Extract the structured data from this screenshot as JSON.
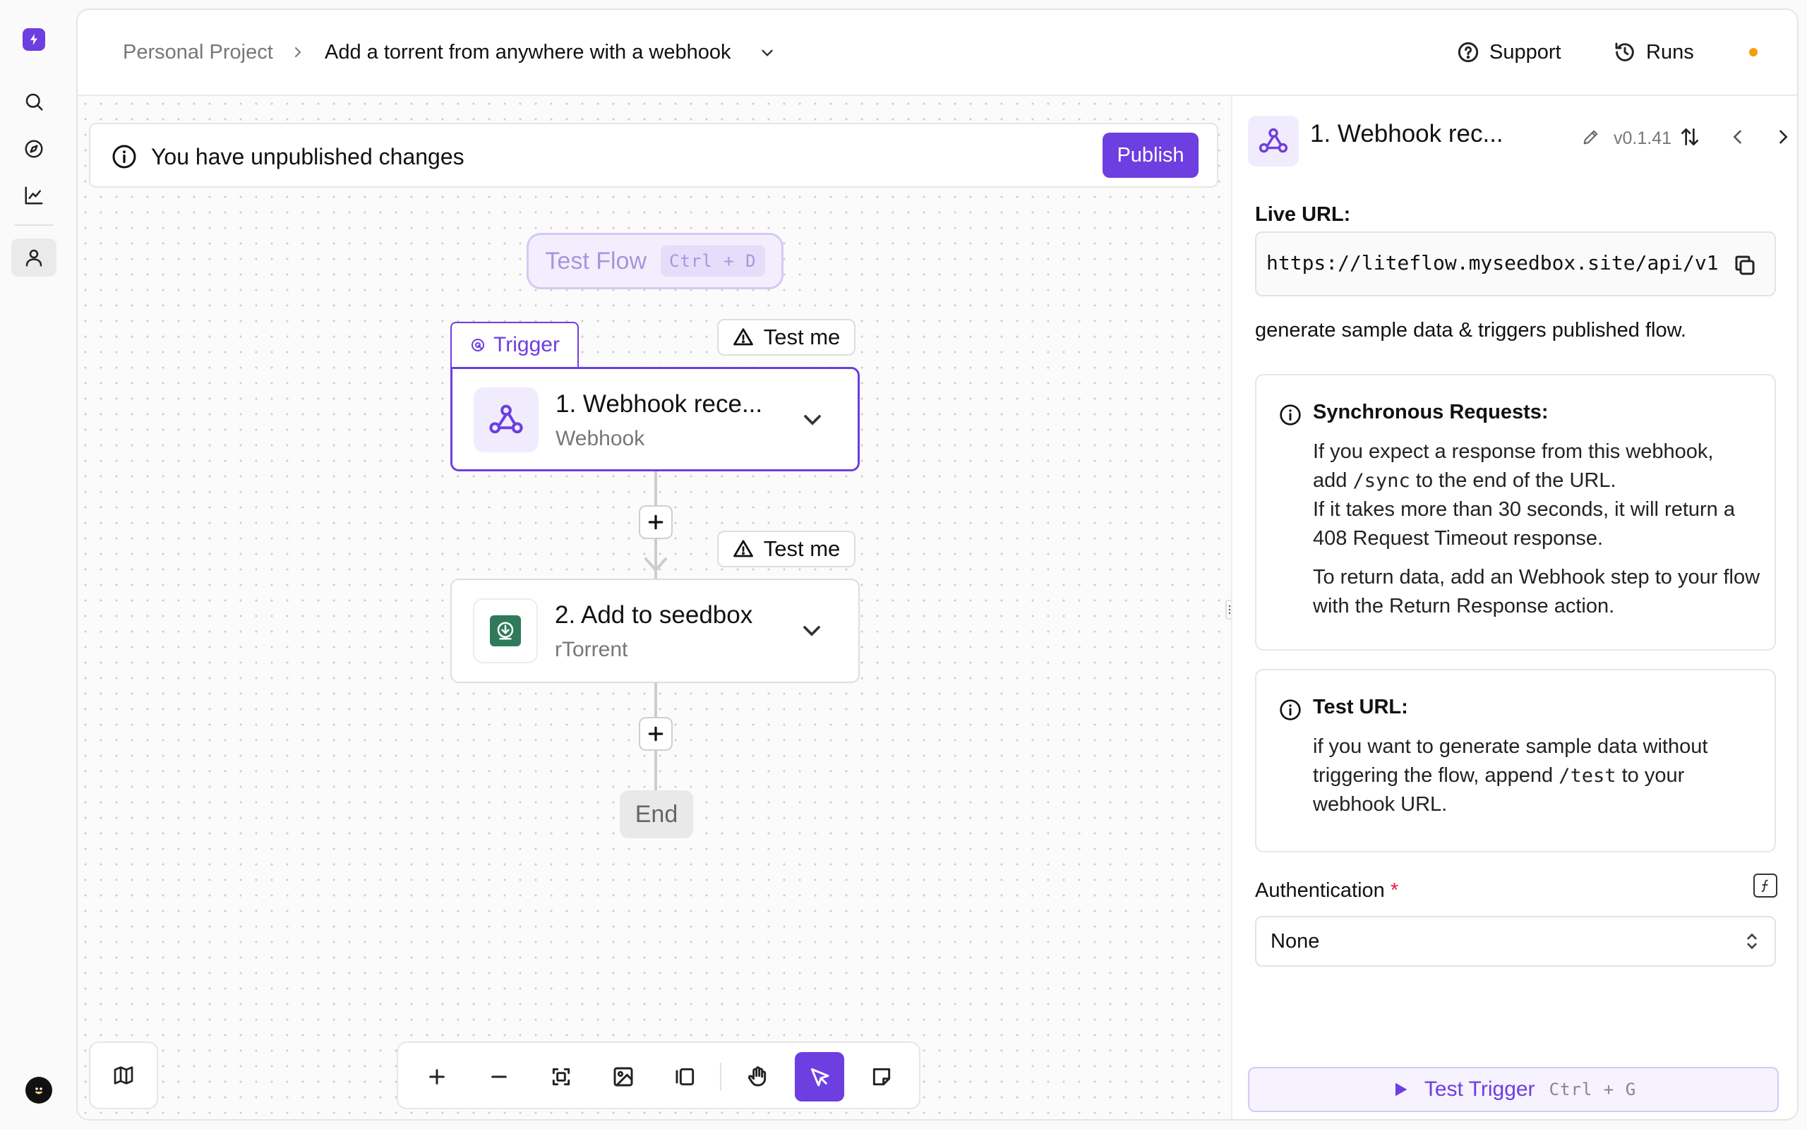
{
  "header": {
    "project": "Personal Project",
    "flow_name": "Add a torrent from anywhere with a webhook",
    "support_label": "Support",
    "runs_label": "Runs"
  },
  "banner": {
    "message": "You have unpublished changes",
    "publish_label": "Publish"
  },
  "canvas": {
    "test_flow_label": "Test Flow",
    "test_flow_shortcut": "Ctrl + D",
    "trigger_tab_label": "Trigger",
    "test_me_label": "Test me",
    "steps": [
      {
        "title": "1. Webhook rece...",
        "subtitle": "Webhook"
      },
      {
        "title": "2. Add to seedbox",
        "subtitle": "rTorrent"
      }
    ],
    "end_label": "End"
  },
  "panel": {
    "title": "1. Webhook rec...",
    "version": "v0.1.41",
    "live_url_label": "Live URL:",
    "live_url": "https://liteflow.myseedbox.site/api/v1",
    "live_url_note": "generate sample data & triggers published flow.",
    "sync_title": "Synchronous Requests:",
    "sync_p1_a": "If you expect a response from this webhook,",
    "sync_p1_b": "add",
    "sync_code": "/sync",
    "sync_p1_c": "to the end of the URL.",
    "sync_p2": "If it takes more than 30 seconds, it will return a 408 Request Timeout response.",
    "sync_p3": "To return data, add an Webhook step to your flow with the Return Response action.",
    "test_url_title": "Test URL:",
    "test_url_a": "if you want to generate sample data without triggering the flow, append",
    "test_url_code": "/test",
    "test_url_b": "to your webhook URL.",
    "auth_label": "Authentication",
    "auth_required": "*",
    "auth_value": "None",
    "test_trigger_label": "Test Trigger",
    "test_trigger_shortcut": "Ctrl + G"
  },
  "colors": {
    "accent": "#6d3ee0",
    "status_dot": "#f59e0b",
    "required": "#e11d48",
    "rtorrent": "#2f7a5b"
  }
}
